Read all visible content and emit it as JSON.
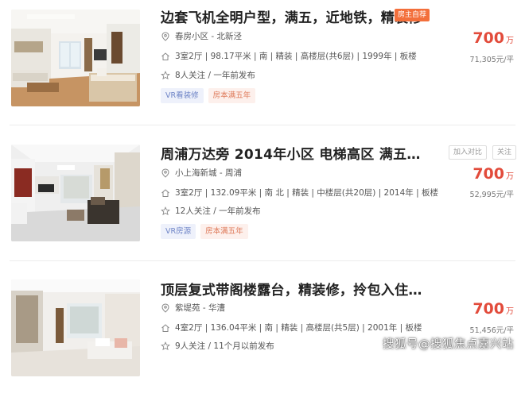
{
  "listings": [
    {
      "title": "边套飞机全明户型，满五，近地铁，精装修",
      "badge": "房主自荐",
      "community": "春房小区 - 北新泾",
      "specs": "3室2厅 | 98.17平米 | 南 | 精装 | 高楼层(共6层) | 1999年 | 板楼",
      "followers": "8人关注 / 一年前发布",
      "tags": [
        "VR看装修",
        "房本满五年"
      ],
      "price": "700",
      "price_unit": "万",
      "unit_price": "71,305元/平"
    },
    {
      "title": "周浦万达旁 2014年小区 电梯高区 满五…",
      "actions": [
        "加入对比",
        "关注"
      ],
      "community": "小上海新城 - 周浦",
      "specs": "3室2厅 | 132.09平米 | 南 北 | 精装 | 中楼层(共20层) | 2014年 | 板楼",
      "followers": "12人关注 / 一年前发布",
      "tags": [
        "VR房源",
        "房本满五年"
      ],
      "price": "700",
      "price_unit": "万",
      "unit_price": "52,995元/平"
    },
    {
      "title": "顶层复式带阁楼露台，精装修，拎包入住…",
      "community": "紫堤苑 - 华漕",
      "specs": "4室2厅 | 136.04平米 | 南 | 精装 | 高楼层(共5层) | 2001年 | 板楼",
      "followers": "9人关注 / 11个月以前发布",
      "price": "700",
      "price_unit": "万",
      "unit_price": "51,456元/平"
    }
  ],
  "icons": {
    "location": "location-pin-icon",
    "house": "house-icon",
    "star": "star-icon"
  },
  "colors": {
    "price": "#e24b3b",
    "badge": "#f36f3b",
    "tag_vr_bg": "#eef1fb",
    "tag_years_bg": "#fdf0ec"
  },
  "watermark": "搜狐号@搜狐焦点嘉兴站"
}
